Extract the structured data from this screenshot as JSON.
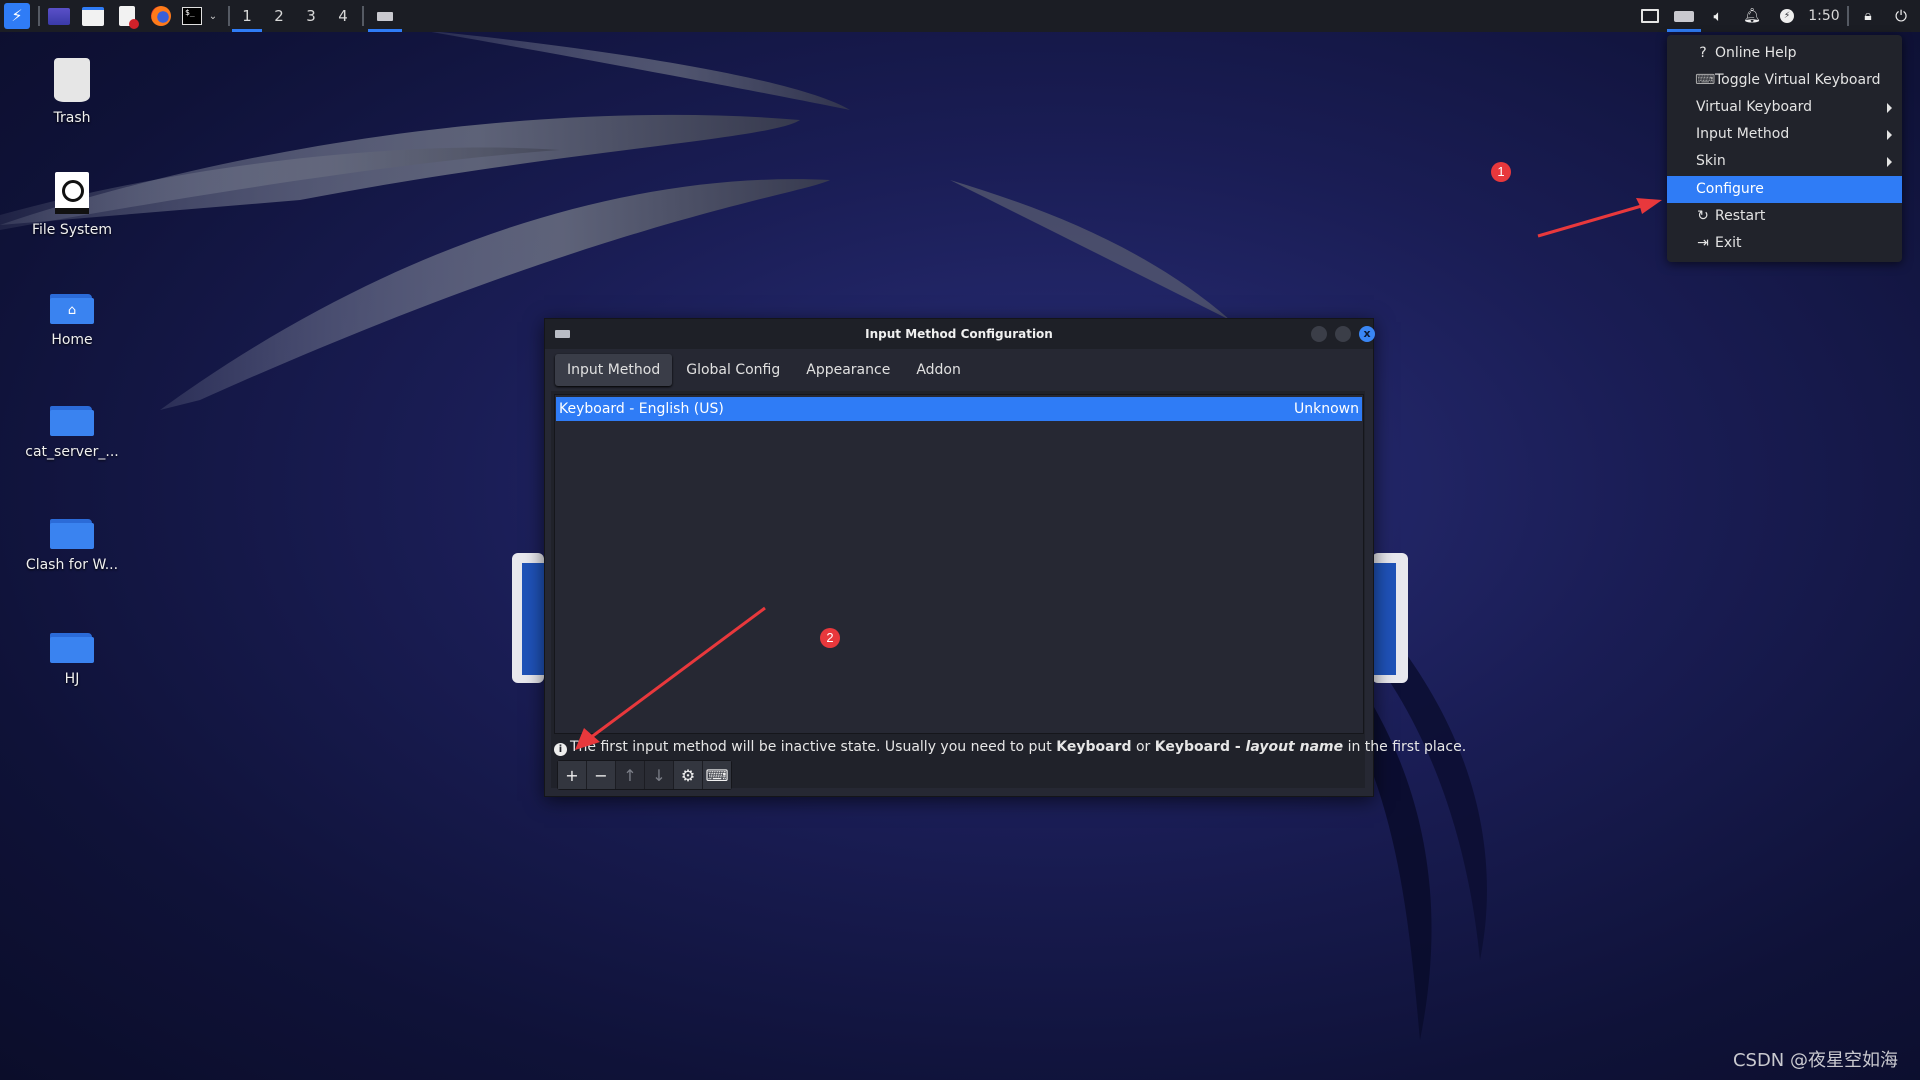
{
  "taskbar": {
    "workspaces": [
      "1",
      "2",
      "3",
      "4"
    ],
    "active_workspace": "1",
    "clock": "1:50",
    "launchers": [
      {
        "name": "kali-menu-icon"
      },
      {
        "name": "show-desktop-icon"
      },
      {
        "name": "file-manager-icon"
      },
      {
        "name": "text-editor-icon"
      },
      {
        "name": "firefox-icon"
      },
      {
        "name": "terminal-icon"
      }
    ],
    "terminal_glyph": "$_"
  },
  "desktop": {
    "icons": [
      {
        "label": "Trash",
        "icon": "trash-icon"
      },
      {
        "label": "File System",
        "icon": "drive-icon"
      },
      {
        "label": "Home",
        "icon": "home-folder-icon"
      },
      {
        "label": "cat_server_...",
        "icon": "folder-icon"
      },
      {
        "label": "Clash for W...",
        "icon": "folder-icon"
      },
      {
        "label": "HJ",
        "icon": "folder-icon"
      }
    ]
  },
  "dialog": {
    "title": "Input Method Configuration",
    "close_glyph": "x",
    "tabs": [
      "Input Method",
      "Global Config",
      "Appearance",
      "Addon"
    ],
    "active_tab": "Input Method",
    "list": [
      {
        "name": "Keyboard - English (US)",
        "status": "Unknown",
        "selected": true
      }
    ],
    "info": {
      "icon_glyph": "i",
      "part1": "The first input method will be inactive state. Usually you need to put ",
      "bold1": "Keyboard",
      "part2": " or ",
      "bold2": "Keyboard - ",
      "italic": "layout name",
      "part3": " in the first place."
    },
    "toolbar": [
      {
        "name": "add",
        "glyph": "+",
        "enabled": true
      },
      {
        "name": "remove",
        "glyph": "−",
        "enabled": true
      },
      {
        "name": "move-up",
        "glyph": "↑",
        "enabled": false
      },
      {
        "name": "move-down",
        "glyph": "↓",
        "enabled": false
      },
      {
        "name": "configure",
        "glyph": "⚙",
        "enabled": true
      },
      {
        "name": "keyboard-layout",
        "glyph": "⌨",
        "enabled": true
      }
    ]
  },
  "tray_menu": {
    "items": [
      {
        "label": "Online Help",
        "icon": "?",
        "submenu": false
      },
      {
        "label": "Toggle Virtual Keyboard",
        "icon": "⌨",
        "submenu": false
      },
      {
        "label": "Virtual Keyboard",
        "icon": "",
        "submenu": true
      },
      {
        "label": "Input Method",
        "icon": "",
        "submenu": true
      },
      {
        "label": "Skin",
        "icon": "",
        "submenu": true
      },
      {
        "label": "Configure",
        "icon": "",
        "submenu": false,
        "selected": true
      },
      {
        "label": "Restart",
        "icon": "↻",
        "submenu": false
      },
      {
        "label": "Exit",
        "icon": "⇥",
        "submenu": false
      }
    ]
  },
  "annotations": {
    "badge1": "1",
    "badge2": "2",
    "accent": "#e8383c"
  },
  "colors": {
    "selection": "#2f7cf6",
    "folder": "#3a83f0"
  },
  "watermark": "CSDN @夜星空如海"
}
